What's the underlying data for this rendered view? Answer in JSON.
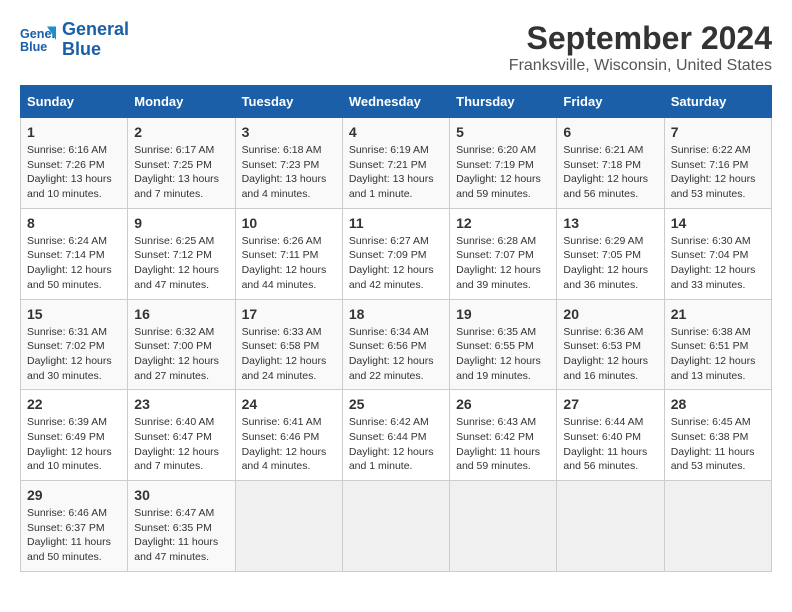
{
  "logo": {
    "line1": "General",
    "line2": "Blue"
  },
  "title": "September 2024",
  "subtitle": "Franksville, Wisconsin, United States",
  "days_of_week": [
    "Sunday",
    "Monday",
    "Tuesday",
    "Wednesday",
    "Thursday",
    "Friday",
    "Saturday"
  ],
  "weeks": [
    [
      {
        "day": "1",
        "info": "Sunrise: 6:16 AM\nSunset: 7:26 PM\nDaylight: 13 hours and 10 minutes."
      },
      {
        "day": "2",
        "info": "Sunrise: 6:17 AM\nSunset: 7:25 PM\nDaylight: 13 hours and 7 minutes."
      },
      {
        "day": "3",
        "info": "Sunrise: 6:18 AM\nSunset: 7:23 PM\nDaylight: 13 hours and 4 minutes."
      },
      {
        "day": "4",
        "info": "Sunrise: 6:19 AM\nSunset: 7:21 PM\nDaylight: 13 hours and 1 minute."
      },
      {
        "day": "5",
        "info": "Sunrise: 6:20 AM\nSunset: 7:19 PM\nDaylight: 12 hours and 59 minutes."
      },
      {
        "day": "6",
        "info": "Sunrise: 6:21 AM\nSunset: 7:18 PM\nDaylight: 12 hours and 56 minutes."
      },
      {
        "day": "7",
        "info": "Sunrise: 6:22 AM\nSunset: 7:16 PM\nDaylight: 12 hours and 53 minutes."
      }
    ],
    [
      {
        "day": "8",
        "info": "Sunrise: 6:24 AM\nSunset: 7:14 PM\nDaylight: 12 hours and 50 minutes."
      },
      {
        "day": "9",
        "info": "Sunrise: 6:25 AM\nSunset: 7:12 PM\nDaylight: 12 hours and 47 minutes."
      },
      {
        "day": "10",
        "info": "Sunrise: 6:26 AM\nSunset: 7:11 PM\nDaylight: 12 hours and 44 minutes."
      },
      {
        "day": "11",
        "info": "Sunrise: 6:27 AM\nSunset: 7:09 PM\nDaylight: 12 hours and 42 minutes."
      },
      {
        "day": "12",
        "info": "Sunrise: 6:28 AM\nSunset: 7:07 PM\nDaylight: 12 hours and 39 minutes."
      },
      {
        "day": "13",
        "info": "Sunrise: 6:29 AM\nSunset: 7:05 PM\nDaylight: 12 hours and 36 minutes."
      },
      {
        "day": "14",
        "info": "Sunrise: 6:30 AM\nSunset: 7:04 PM\nDaylight: 12 hours and 33 minutes."
      }
    ],
    [
      {
        "day": "15",
        "info": "Sunrise: 6:31 AM\nSunset: 7:02 PM\nDaylight: 12 hours and 30 minutes."
      },
      {
        "day": "16",
        "info": "Sunrise: 6:32 AM\nSunset: 7:00 PM\nDaylight: 12 hours and 27 minutes."
      },
      {
        "day": "17",
        "info": "Sunrise: 6:33 AM\nSunset: 6:58 PM\nDaylight: 12 hours and 24 minutes."
      },
      {
        "day": "18",
        "info": "Sunrise: 6:34 AM\nSunset: 6:56 PM\nDaylight: 12 hours and 22 minutes."
      },
      {
        "day": "19",
        "info": "Sunrise: 6:35 AM\nSunset: 6:55 PM\nDaylight: 12 hours and 19 minutes."
      },
      {
        "day": "20",
        "info": "Sunrise: 6:36 AM\nSunset: 6:53 PM\nDaylight: 12 hours and 16 minutes."
      },
      {
        "day": "21",
        "info": "Sunrise: 6:38 AM\nSunset: 6:51 PM\nDaylight: 12 hours and 13 minutes."
      }
    ],
    [
      {
        "day": "22",
        "info": "Sunrise: 6:39 AM\nSunset: 6:49 PM\nDaylight: 12 hours and 10 minutes."
      },
      {
        "day": "23",
        "info": "Sunrise: 6:40 AM\nSunset: 6:47 PM\nDaylight: 12 hours and 7 minutes."
      },
      {
        "day": "24",
        "info": "Sunrise: 6:41 AM\nSunset: 6:46 PM\nDaylight: 12 hours and 4 minutes."
      },
      {
        "day": "25",
        "info": "Sunrise: 6:42 AM\nSunset: 6:44 PM\nDaylight: 12 hours and 1 minute."
      },
      {
        "day": "26",
        "info": "Sunrise: 6:43 AM\nSunset: 6:42 PM\nDaylight: 11 hours and 59 minutes."
      },
      {
        "day": "27",
        "info": "Sunrise: 6:44 AM\nSunset: 6:40 PM\nDaylight: 11 hours and 56 minutes."
      },
      {
        "day": "28",
        "info": "Sunrise: 6:45 AM\nSunset: 6:38 PM\nDaylight: 11 hours and 53 minutes."
      }
    ],
    [
      {
        "day": "29",
        "info": "Sunrise: 6:46 AM\nSunset: 6:37 PM\nDaylight: 11 hours and 50 minutes."
      },
      {
        "day": "30",
        "info": "Sunrise: 6:47 AM\nSunset: 6:35 PM\nDaylight: 11 hours and 47 minutes."
      },
      {
        "day": "",
        "info": ""
      },
      {
        "day": "",
        "info": ""
      },
      {
        "day": "",
        "info": ""
      },
      {
        "day": "",
        "info": ""
      },
      {
        "day": "",
        "info": ""
      }
    ]
  ]
}
